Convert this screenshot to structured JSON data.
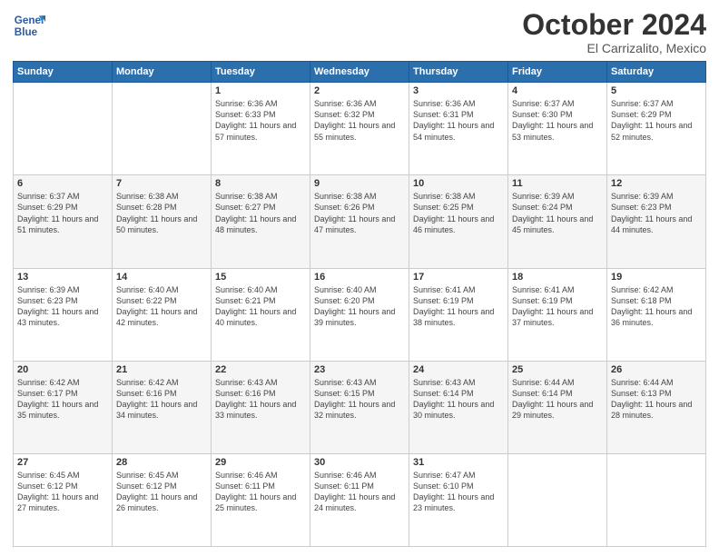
{
  "header": {
    "logo_line1": "General",
    "logo_line2": "Blue",
    "month": "October 2024",
    "location": "El Carrizalito, Mexico"
  },
  "days_of_week": [
    "Sunday",
    "Monday",
    "Tuesday",
    "Wednesday",
    "Thursday",
    "Friday",
    "Saturday"
  ],
  "weeks": [
    [
      {
        "day": "",
        "info": ""
      },
      {
        "day": "",
        "info": ""
      },
      {
        "day": "1",
        "info": "Sunrise: 6:36 AM\nSunset: 6:33 PM\nDaylight: 11 hours and 57 minutes."
      },
      {
        "day": "2",
        "info": "Sunrise: 6:36 AM\nSunset: 6:32 PM\nDaylight: 11 hours and 55 minutes."
      },
      {
        "day": "3",
        "info": "Sunrise: 6:36 AM\nSunset: 6:31 PM\nDaylight: 11 hours and 54 minutes."
      },
      {
        "day": "4",
        "info": "Sunrise: 6:37 AM\nSunset: 6:30 PM\nDaylight: 11 hours and 53 minutes."
      },
      {
        "day": "5",
        "info": "Sunrise: 6:37 AM\nSunset: 6:29 PM\nDaylight: 11 hours and 52 minutes."
      }
    ],
    [
      {
        "day": "6",
        "info": "Sunrise: 6:37 AM\nSunset: 6:29 PM\nDaylight: 11 hours and 51 minutes."
      },
      {
        "day": "7",
        "info": "Sunrise: 6:38 AM\nSunset: 6:28 PM\nDaylight: 11 hours and 50 minutes."
      },
      {
        "day": "8",
        "info": "Sunrise: 6:38 AM\nSunset: 6:27 PM\nDaylight: 11 hours and 48 minutes."
      },
      {
        "day": "9",
        "info": "Sunrise: 6:38 AM\nSunset: 6:26 PM\nDaylight: 11 hours and 47 minutes."
      },
      {
        "day": "10",
        "info": "Sunrise: 6:38 AM\nSunset: 6:25 PM\nDaylight: 11 hours and 46 minutes."
      },
      {
        "day": "11",
        "info": "Sunrise: 6:39 AM\nSunset: 6:24 PM\nDaylight: 11 hours and 45 minutes."
      },
      {
        "day": "12",
        "info": "Sunrise: 6:39 AM\nSunset: 6:23 PM\nDaylight: 11 hours and 44 minutes."
      }
    ],
    [
      {
        "day": "13",
        "info": "Sunrise: 6:39 AM\nSunset: 6:23 PM\nDaylight: 11 hours and 43 minutes."
      },
      {
        "day": "14",
        "info": "Sunrise: 6:40 AM\nSunset: 6:22 PM\nDaylight: 11 hours and 42 minutes."
      },
      {
        "day": "15",
        "info": "Sunrise: 6:40 AM\nSunset: 6:21 PM\nDaylight: 11 hours and 40 minutes."
      },
      {
        "day": "16",
        "info": "Sunrise: 6:40 AM\nSunset: 6:20 PM\nDaylight: 11 hours and 39 minutes."
      },
      {
        "day": "17",
        "info": "Sunrise: 6:41 AM\nSunset: 6:19 PM\nDaylight: 11 hours and 38 minutes."
      },
      {
        "day": "18",
        "info": "Sunrise: 6:41 AM\nSunset: 6:19 PM\nDaylight: 11 hours and 37 minutes."
      },
      {
        "day": "19",
        "info": "Sunrise: 6:42 AM\nSunset: 6:18 PM\nDaylight: 11 hours and 36 minutes."
      }
    ],
    [
      {
        "day": "20",
        "info": "Sunrise: 6:42 AM\nSunset: 6:17 PM\nDaylight: 11 hours and 35 minutes."
      },
      {
        "day": "21",
        "info": "Sunrise: 6:42 AM\nSunset: 6:16 PM\nDaylight: 11 hours and 34 minutes."
      },
      {
        "day": "22",
        "info": "Sunrise: 6:43 AM\nSunset: 6:16 PM\nDaylight: 11 hours and 33 minutes."
      },
      {
        "day": "23",
        "info": "Sunrise: 6:43 AM\nSunset: 6:15 PM\nDaylight: 11 hours and 32 minutes."
      },
      {
        "day": "24",
        "info": "Sunrise: 6:43 AM\nSunset: 6:14 PM\nDaylight: 11 hours and 30 minutes."
      },
      {
        "day": "25",
        "info": "Sunrise: 6:44 AM\nSunset: 6:14 PM\nDaylight: 11 hours and 29 minutes."
      },
      {
        "day": "26",
        "info": "Sunrise: 6:44 AM\nSunset: 6:13 PM\nDaylight: 11 hours and 28 minutes."
      }
    ],
    [
      {
        "day": "27",
        "info": "Sunrise: 6:45 AM\nSunset: 6:12 PM\nDaylight: 11 hours and 27 minutes."
      },
      {
        "day": "28",
        "info": "Sunrise: 6:45 AM\nSunset: 6:12 PM\nDaylight: 11 hours and 26 minutes."
      },
      {
        "day": "29",
        "info": "Sunrise: 6:46 AM\nSunset: 6:11 PM\nDaylight: 11 hours and 25 minutes."
      },
      {
        "day": "30",
        "info": "Sunrise: 6:46 AM\nSunset: 6:11 PM\nDaylight: 11 hours and 24 minutes."
      },
      {
        "day": "31",
        "info": "Sunrise: 6:47 AM\nSunset: 6:10 PM\nDaylight: 11 hours and 23 minutes."
      },
      {
        "day": "",
        "info": ""
      },
      {
        "day": "",
        "info": ""
      }
    ]
  ]
}
